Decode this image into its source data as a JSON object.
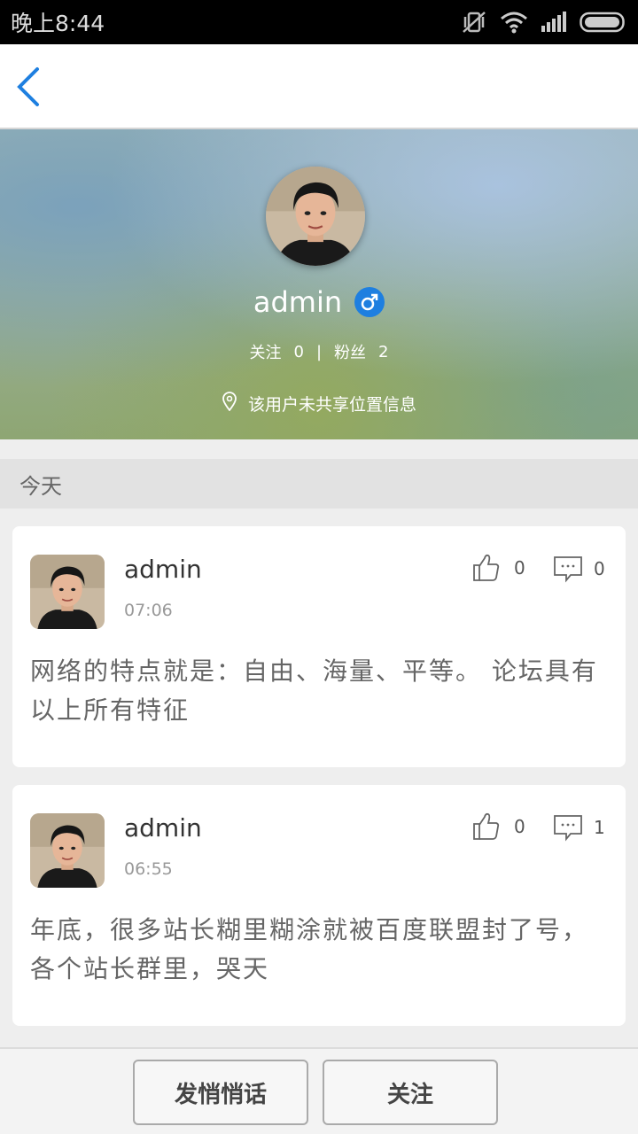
{
  "status_bar": {
    "time": "晚上8:44"
  },
  "profile": {
    "username": "admin",
    "following_label": "关注",
    "following_count": "0",
    "separator": "|",
    "followers_label": "粉丝",
    "followers_count": "2",
    "location_text": "该用户未共享位置信息"
  },
  "section": {
    "title": "今天"
  },
  "posts": [
    {
      "author": "admin",
      "time": "07:06",
      "likes": "0",
      "comments": "0",
      "content": "网络的特点就是：自由、海量、平等。 论坛具有以上所有特征"
    },
    {
      "author": "admin",
      "time": "06:55",
      "likes": "0",
      "comments": "1",
      "content": "年底，很多站长糊里糊涂就被百度联盟封了号，各个站长群里，哭天"
    }
  ],
  "bottom_bar": {
    "message_label": "发悄悄话",
    "follow_label": "关注"
  },
  "colors": {
    "accent": "#1e7fe0",
    "navbar_bg": "#ffffff",
    "page_bg": "#eeeeee"
  }
}
